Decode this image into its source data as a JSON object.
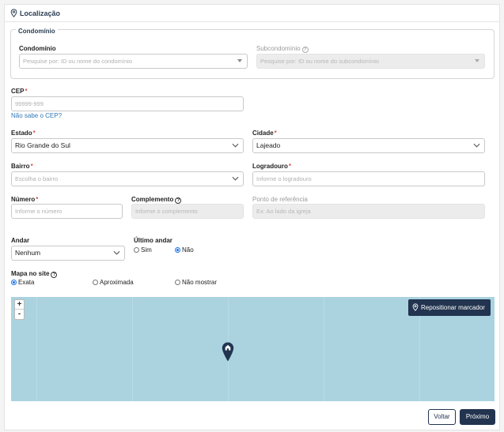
{
  "header": {
    "title": "Localização"
  },
  "condominio_section": {
    "legend": "Condomínio",
    "condominio": {
      "label": "Condomínio",
      "placeholder": "Pesquise por: ID ou nome do condomínio"
    },
    "subcondominio": {
      "label": "Subcondomínio",
      "placeholder": "Pesquise por: ID ou nome do subcondomínio"
    }
  },
  "cep": {
    "label": "CEP",
    "placeholder": "99999-999",
    "help_link": "Não sabe o CEP?"
  },
  "estado": {
    "label": "Estado",
    "value": "Rio Grande do Sul"
  },
  "cidade": {
    "label": "Cidade",
    "value": "Lajeado"
  },
  "bairro": {
    "label": "Bairro",
    "placeholder": "Escolha o bairro"
  },
  "logradouro": {
    "label": "Logradouro",
    "placeholder": "Informe o logradouro"
  },
  "numero": {
    "label": "Número",
    "placeholder": "Informe o número"
  },
  "complemento": {
    "label": "Complemento",
    "placeholder": "Informe o complemento"
  },
  "ponto_referencia": {
    "label": "Ponto de referência",
    "placeholder": "Ex: Ao lado da igreja"
  },
  "andar": {
    "label": "Andar",
    "value": "Nenhum"
  },
  "ultimo_andar": {
    "label": "Último andar",
    "options": [
      "Sim",
      "Não"
    ],
    "selected": "Não"
  },
  "mapa_no_site": {
    "label": "Mapa no site",
    "options": [
      "Exata",
      "Aproximada",
      "Não mostrar"
    ],
    "selected": "Exata"
  },
  "map": {
    "zoom_in": "+",
    "zoom_out": "-",
    "reposition_button": "Repositionar marcador"
  },
  "footer": {
    "back": "Voltar",
    "next": "Próximo"
  },
  "colors": {
    "primary": "#22344f",
    "link": "#2f77b7",
    "required": "#d9534f",
    "map_water": "#aad3df"
  },
  "icons": {
    "header": "map-pin-icon",
    "map_marker": "map-marker-icon",
    "help": "question-circle-icon"
  }
}
